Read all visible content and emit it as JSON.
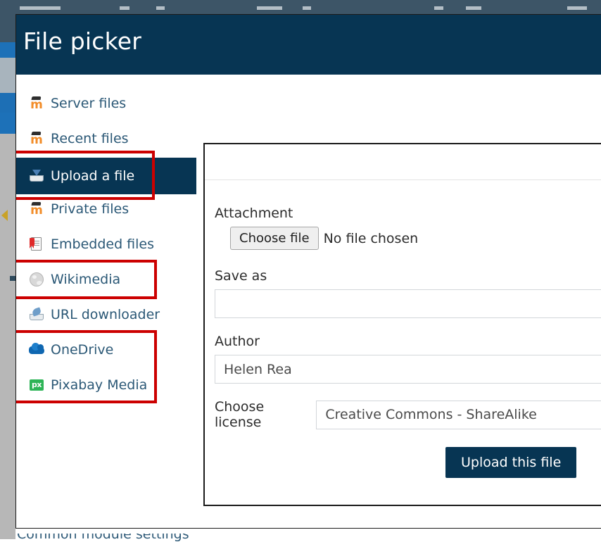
{
  "background": {
    "navbar_items": 8,
    "bottom_cutoff_text": "Common module settings"
  },
  "modal": {
    "title": "File picker",
    "sidebar": {
      "items": [
        {
          "label": "Server files",
          "icon": "moodle-icon",
          "selected": false,
          "highlighted": false
        },
        {
          "label": "Recent files",
          "icon": "moodle-icon",
          "selected": false,
          "highlighted": false
        },
        {
          "label": "Upload a file",
          "icon": "upload-tray-icon",
          "selected": true,
          "highlighted": true
        },
        {
          "label": "Private files",
          "icon": "moodle-icon",
          "selected": false,
          "highlighted": false
        },
        {
          "label": "Embedded files",
          "icon": "document-icon",
          "selected": false,
          "highlighted": false
        },
        {
          "label": "Wikimedia",
          "icon": "wikipedia-globe-icon",
          "selected": false,
          "highlighted": true
        },
        {
          "label": "URL downloader",
          "icon": "url-download-icon",
          "selected": false,
          "highlighted": false
        },
        {
          "label": "OneDrive",
          "icon": "onedrive-cloud-icon",
          "selected": false,
          "highlighted": true
        },
        {
          "label": "Pixabay Media",
          "icon": "pixabay-icon",
          "selected": false,
          "highlighted": true
        }
      ]
    },
    "form": {
      "attachment_label": "Attachment",
      "choose_file_button": "Choose file",
      "no_file_chosen": "No file chosen",
      "save_as_label": "Save as",
      "save_as_value": "",
      "save_as_placeholder": "",
      "author_label": "Author",
      "author_value": "Helen Rea",
      "license_label": "Choose license",
      "license_value": "Creative Commons - ShareAlike",
      "license_options": [
        "Creative Commons - ShareAlike"
      ],
      "upload_button": "Upload this file"
    }
  },
  "colors": {
    "brand_navy": "#073553",
    "link_blue": "#2b5876",
    "highlight_red": "#cc0000",
    "moodle_orange": "#f28c28",
    "onedrive_blue": "#0f67b1",
    "pixabay_green": "#2eb457"
  }
}
